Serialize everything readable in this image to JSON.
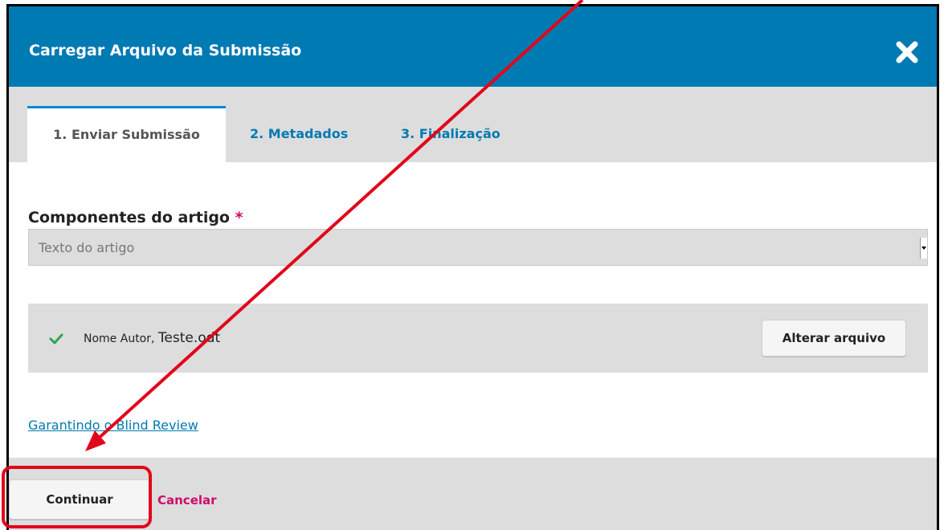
{
  "dialog": {
    "title": "Carregar Arquivo da Submissão",
    "close_icon": "close-icon"
  },
  "tabs": [
    {
      "label": "1. Enviar Submissão",
      "active": true
    },
    {
      "label": "2. Metadados",
      "active": false
    },
    {
      "label": "3. Finalização",
      "active": false
    }
  ],
  "form": {
    "component_label": "Componentes do artigo",
    "required_mark": "*",
    "component_selected": "Texto do artigo"
  },
  "file": {
    "status_icon": "check-icon",
    "author_part": "Nome Autor, ",
    "file_part": "Teste.odt",
    "change_button": "Alterar arquivo"
  },
  "blind_review_link": "Garantindo o Blind Review",
  "footer": {
    "continue_button": "Continuar",
    "cancel_link": "Cancelar"
  },
  "colors": {
    "header_bg": "#007ab2",
    "link": "#007ab2",
    "accent_pink": "#d00a6c",
    "annotation_red": "#e2061b",
    "check_green": "#2ba84a"
  }
}
